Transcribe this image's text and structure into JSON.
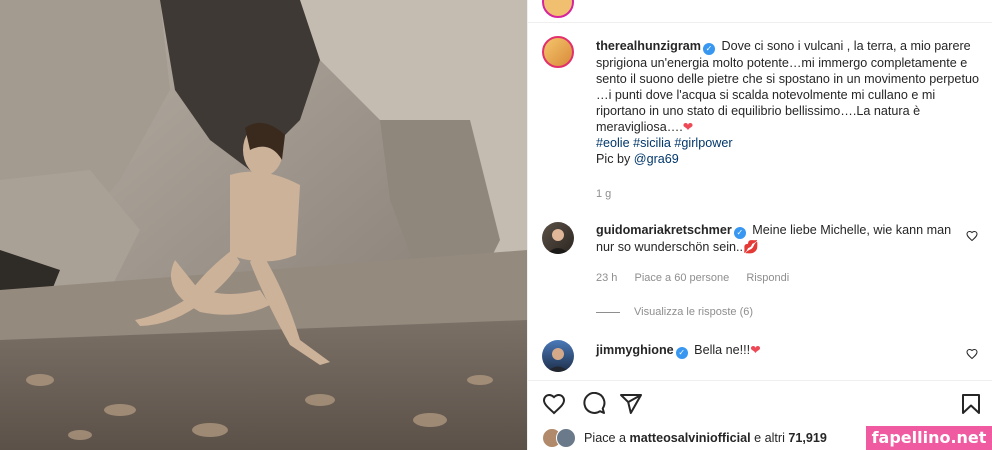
{
  "post": {
    "username": "therealhunzigram",
    "caption": "Dove ci sono i vulcani , la terra, a mio parere sprigiona un'energia molto potente…mi immergo completamente e sento il suono delle pietre che si spostano in un movimento perpetuo …i punti dove l'acqua si scalda notevolmente mi cullano e mi riportano in uno stato di equilibrio bellissimo….La natura è meravigliosa….",
    "heart": "❤",
    "hashtags": [
      "#eolie",
      "#sicilia",
      "#girlpower"
    ],
    "credit_prefix": "Pic by ",
    "credit_handle": "@gra69",
    "time": "1 g"
  },
  "comments": [
    {
      "username": "guidomariakretschmer",
      "text": "Meine liebe Michelle, wie kann man nur so wunderschön sein..",
      "emoji": "💋",
      "time": "23 h",
      "likes": "Piace a 60 persone",
      "reply": "Rispondi",
      "view_replies": "Visualizza le risposte (6)"
    },
    {
      "username": "jimmyghione",
      "text": "Bella ne!!!",
      "emoji": "❤"
    }
  ],
  "likes": {
    "prefix": "Piace a ",
    "user": "matteosalviniofficial",
    "suffix": " e altri ",
    "count": "71,919"
  },
  "icons": [
    "heart-icon",
    "comment-icon",
    "share-icon",
    "bookmark-icon",
    "verified-icon"
  ],
  "watermark": "fapellino.net",
  "colors": {
    "link": "#00376b",
    "verified": "#3897f0",
    "heart": "#ed4956",
    "watermark_bg": "#f05aa0"
  }
}
